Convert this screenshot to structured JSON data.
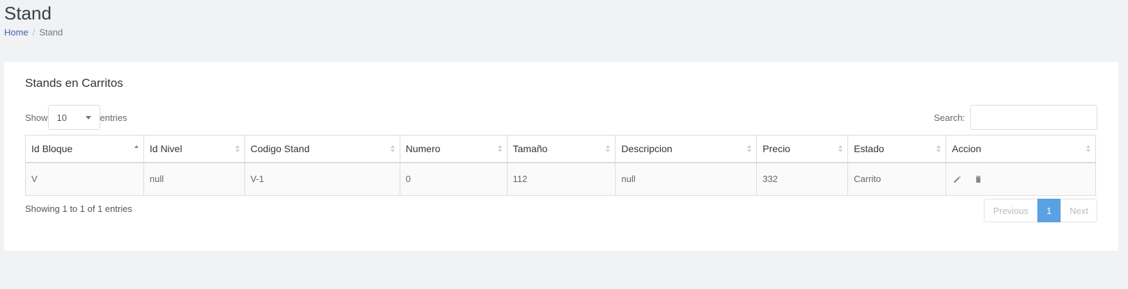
{
  "header": {
    "title": "Stand"
  },
  "breadcrumb": {
    "home": "Home",
    "separator": "/",
    "current": "Stand"
  },
  "card": {
    "title": "Stands en Carritos"
  },
  "length": {
    "prefix": "Show",
    "value": "10",
    "suffix": "entries"
  },
  "search": {
    "label": "Search:"
  },
  "table": {
    "columns": [
      "Id Bloque",
      "Id Nivel",
      "Codigo Stand",
      "Numero",
      "Tamaño",
      "Descripcion",
      "Precio",
      "Estado",
      "Accion"
    ],
    "rows": [
      [
        "V",
        "null",
        "V-1",
        "0",
        "112",
        "null",
        "332",
        "Carrito"
      ]
    ]
  },
  "actions": {
    "edit_icon": "pencil-icon",
    "delete_icon": "trash-icon"
  },
  "info": "Showing 1 to 1 of 1 entries",
  "pagination": {
    "previous": "Previous",
    "page": "1",
    "next": "Next"
  },
  "colors": {
    "accent": "#5aa1e3",
    "link": "#3f62b0",
    "background": "#f0f2f3"
  }
}
